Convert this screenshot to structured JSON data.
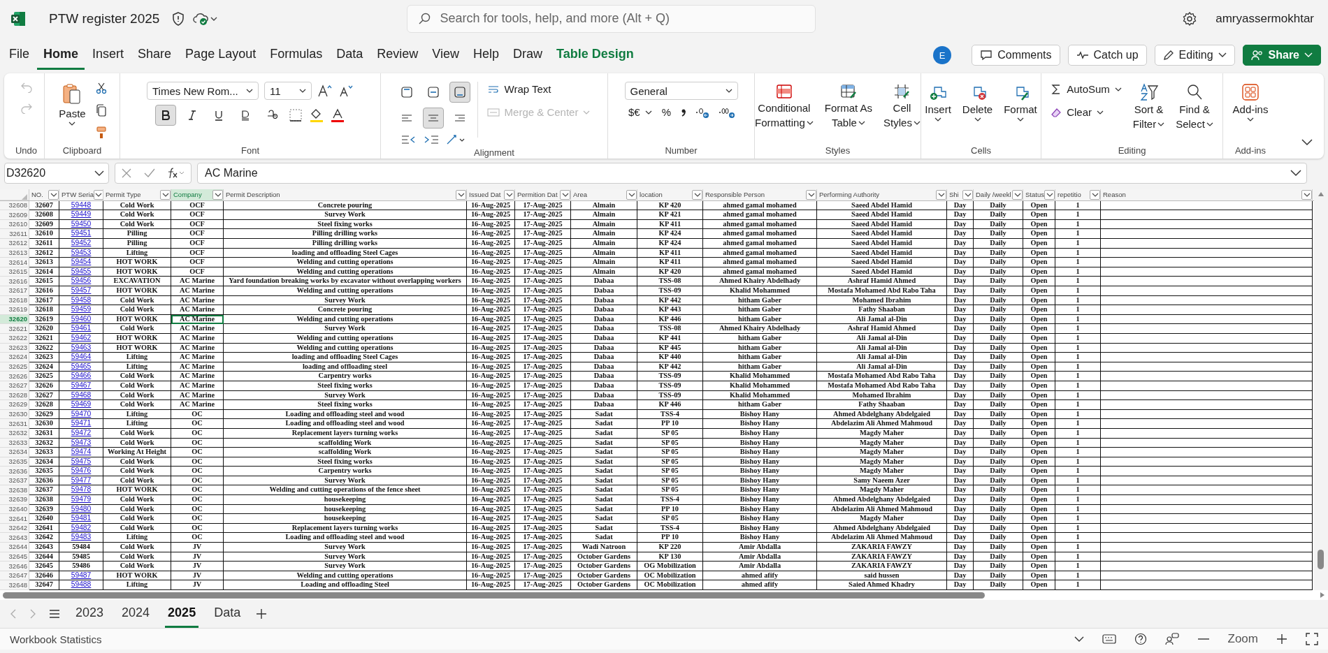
{
  "app": {
    "title": "PTW register 2025",
    "search_placeholder": "Search for tools, help, and more (Alt + Q)",
    "user": "amryassermokhtar"
  },
  "menu_tabs": [
    {
      "label": "File",
      "selected": false,
      "kind": "tab"
    },
    {
      "label": "Home",
      "selected": true,
      "kind": "tab"
    },
    {
      "label": "Insert",
      "selected": false,
      "kind": "tab"
    },
    {
      "label": "Share",
      "selected": false,
      "kind": "tab"
    },
    {
      "label": "Page Layout",
      "selected": false,
      "kind": "tab"
    },
    {
      "label": "Formulas",
      "selected": false,
      "kind": "tab"
    },
    {
      "label": "Data",
      "selected": false,
      "kind": "tab"
    },
    {
      "label": "Review",
      "selected": false,
      "kind": "tab"
    },
    {
      "label": "View",
      "selected": false,
      "kind": "tab"
    },
    {
      "label": "Help",
      "selected": false,
      "kind": "tab"
    },
    {
      "label": "Draw",
      "selected": false,
      "kind": "tab"
    },
    {
      "label": "Table Design",
      "selected": false,
      "kind": "contextual"
    }
  ],
  "header_actions": {
    "avatar": "E",
    "comments": "Comments",
    "catch_up": "Catch up",
    "mode": "Editing",
    "share": "Share"
  },
  "ribbon": {
    "history": {
      "group": "Undo",
      "disabled": true
    },
    "clipboard": {
      "group": "Clipboard",
      "paste": "Paste"
    },
    "font": {
      "group": "Font",
      "family": "Times New Rom...",
      "size": "11",
      "styles": [
        {
          "kind": "bold",
          "selected": true
        },
        {
          "kind": "italic",
          "selected": false
        },
        {
          "kind": "underline",
          "selected": false
        },
        {
          "kind": "double-underline",
          "selected": false
        },
        {
          "kind": "strike",
          "selected": false
        }
      ]
    },
    "alignment": {
      "group": "Alignment",
      "vertical": [
        {
          "kind": "top",
          "selected": false
        },
        {
          "kind": "middle",
          "selected": false
        },
        {
          "kind": "bottom",
          "selected": true
        }
      ],
      "horizontal": [
        {
          "kind": "left",
          "selected": false
        },
        {
          "kind": "center",
          "selected": true
        },
        {
          "kind": "right",
          "selected": false
        }
      ],
      "wrap": "Wrap Text",
      "merge": "Merge & Center",
      "merge_disabled": true
    },
    "number": {
      "group": "Number",
      "format": "General",
      "currency": "$€",
      "percent": "%"
    },
    "styles": {
      "group": "Styles",
      "buttons": [
        {
          "kind": "conditional",
          "lines": [
            "Conditional",
            "Formatting"
          ]
        },
        {
          "kind": "table",
          "lines": [
            "Format As",
            "Table"
          ]
        },
        {
          "kind": "cell",
          "lines": [
            "Cell",
            "Styles"
          ]
        }
      ]
    },
    "cells": {
      "group": "Cells",
      "buttons": [
        {
          "kind": "insert",
          "label": "Insert"
        },
        {
          "kind": "delete",
          "label": "Delete"
        },
        {
          "kind": "format",
          "label": "Format"
        }
      ]
    },
    "editing": {
      "group": "Editing",
      "autosum": "AutoSum",
      "clear": "Clear",
      "buttons": [
        {
          "kind": "sort",
          "lines": [
            "Sort &",
            "Filter"
          ]
        },
        {
          "kind": "find",
          "lines": [
            "Find &",
            "Select"
          ]
        }
      ]
    },
    "addins": {
      "group": "Add-ins",
      "label": "Add-ins"
    }
  },
  "formula_bar": {
    "name_box": "D32620",
    "value": "AC Marine"
  },
  "columns": [
    {
      "label": "NO.",
      "selected": false
    },
    {
      "label": "PTW Seria",
      "selected": false
    },
    {
      "label": "Permit Type",
      "selected": false
    },
    {
      "label": "Company",
      "selected": true
    },
    {
      "label": "Permit Description",
      "selected": false
    },
    {
      "label": "Issued Dat",
      "selected": false
    },
    {
      "label": "Permition Dat",
      "selected": false
    },
    {
      "label": "Area",
      "selected": false
    },
    {
      "label": "location",
      "selected": false
    },
    {
      "label": "Responsible Person",
      "selected": false
    },
    {
      "label": "Performing Authority",
      "selected": false
    },
    {
      "label": "Shi",
      "selected": false
    },
    {
      "label": "Daily /weekl",
      "selected": false
    },
    {
      "label": "Status",
      "selected": false
    },
    {
      "label": "repetitio",
      "selected": false
    },
    {
      "label": "Reason",
      "selected": false
    }
  ],
  "rows": [
    {
      "row": "32608",
      "no": "32607",
      "serial": "59448",
      "link": true,
      "type": "Cold Work",
      "company": "OCF",
      "description": "Concrete pouring",
      "issued": "16-Aug-2025",
      "permition": "17-Aug-2025",
      "area": "Almain",
      "location": "KP 420",
      "responsible": "ahmed gamal mohamed",
      "performing": "Saeed Abdel Hamid",
      "shift": "Day",
      "frequency": "Daily",
      "status": "Open",
      "repetition": "1",
      "selected": false
    },
    {
      "row": "32609",
      "no": "32608",
      "serial": "59449",
      "link": true,
      "type": "Cold Work",
      "company": "OCF",
      "description": "Survey Work",
      "issued": "16-Aug-2025",
      "permition": "17-Aug-2025",
      "area": "Almain",
      "location": "KP 421",
      "responsible": "ahmed gamal mohamed",
      "performing": "Saeed Abdel Hamid",
      "shift": "Day",
      "frequency": "Daily",
      "status": "Open",
      "repetition": "1",
      "selected": false
    },
    {
      "row": "32610",
      "no": "32609",
      "serial": "59450",
      "link": true,
      "type": "Cold Work",
      "company": "OCF",
      "description": "Steel fixing works",
      "issued": "16-Aug-2025",
      "permition": "17-Aug-2025",
      "area": "Almain",
      "location": "KP 411",
      "responsible": "ahmed gamal mohamed",
      "performing": "Saeed Abdel Hamid",
      "shift": "Day",
      "frequency": "Daily",
      "status": "Open",
      "repetition": "1",
      "selected": false
    },
    {
      "row": "32611",
      "no": "32610",
      "serial": "59451",
      "link": true,
      "type": "Pilling",
      "company": "OCF",
      "description": "Pilling drilling works",
      "issued": "16-Aug-2025",
      "permition": "17-Aug-2025",
      "area": "Almain",
      "location": "KP 424",
      "responsible": "ahmed gamal mohamed",
      "performing": "Saeed Abdel Hamid",
      "shift": "Day",
      "frequency": "Daily",
      "status": "Open",
      "repetition": "1",
      "selected": false
    },
    {
      "row": "32612",
      "no": "32611",
      "serial": "59452",
      "link": true,
      "type": "Pilling",
      "company": "OCF",
      "description": "Pilling drilling works",
      "issued": "16-Aug-2025",
      "permition": "17-Aug-2025",
      "area": "Almain",
      "location": "KP 424",
      "responsible": "ahmed gamal mohamed",
      "performing": "Saeed Abdel Hamid",
      "shift": "Day",
      "frequency": "Daily",
      "status": "Open",
      "repetition": "1",
      "selected": false
    },
    {
      "row": "32613",
      "no": "32612",
      "serial": "59453",
      "link": true,
      "type": "Lifting",
      "company": "OCF",
      "description": "loading and offloading  Steel Cages",
      "issued": "16-Aug-2025",
      "permition": "17-Aug-2025",
      "area": "Almain",
      "location": "KP 411",
      "responsible": "ahmed gamal mohamed",
      "performing": "Saeed Abdel Hamid",
      "shift": "Day",
      "frequency": "Daily",
      "status": "Open",
      "repetition": "1",
      "selected": false
    },
    {
      "row": "32614",
      "no": "32613",
      "serial": "59454",
      "link": true,
      "type": "HOT WORK",
      "company": "OCF",
      "description": "Welding and cutting operations",
      "issued": "16-Aug-2025",
      "permition": "17-Aug-2025",
      "area": "Almain",
      "location": "KP 411",
      "responsible": "ahmed gamal mohamed",
      "performing": "Saeed Abdel Hamid",
      "shift": "Day",
      "frequency": "Daily",
      "status": "Open",
      "repetition": "1",
      "selected": false
    },
    {
      "row": "32615",
      "no": "32614",
      "serial": "59455",
      "link": true,
      "type": "HOT WORK",
      "company": "OCF",
      "description": "Welding and cutting operations",
      "issued": "16-Aug-2025",
      "permition": "17-Aug-2025",
      "area": "Almain",
      "location": "KP 420",
      "responsible": "ahmed gamal mohamed",
      "performing": "Saeed Abdel Hamid",
      "shift": "Day",
      "frequency": "Daily",
      "status": "Open",
      "repetition": "1",
      "selected": false
    },
    {
      "row": "32616",
      "no": "32615",
      "serial": "59456",
      "link": true,
      "type": "EXCAVATION",
      "company": "AC Marine",
      "description": "Yard foundation breaking works by excavator without overlapping workers",
      "issued": "16-Aug-2025",
      "permition": "17-Aug-2025",
      "area": "Dabaa",
      "location": "TSS-08",
      "responsible": "Ahmed Khairy Abdelhady",
      "performing": "Ashraf Hamid Ahmed",
      "shift": "Day",
      "frequency": "Daily",
      "status": "Open",
      "repetition": "1",
      "selected": false
    },
    {
      "row": "32617",
      "no": "32616",
      "serial": "59457",
      "link": true,
      "type": "HOT WORK",
      "company": "AC Marine",
      "description": "Welding and cutting operations",
      "issued": "16-Aug-2025",
      "permition": "17-Aug-2025",
      "area": "Dabaa",
      "location": "TSS-09",
      "responsible": "Khalid Mohammed",
      "performing": "Mostafa Mohamed Abd Rabo Taha",
      "shift": "Day",
      "frequency": "Daily",
      "status": "Open",
      "repetition": "1",
      "selected": false
    },
    {
      "row": "32618",
      "no": "32617",
      "serial": "59458",
      "link": true,
      "type": "Cold Work",
      "company": "AC Marine",
      "description": "Survey Work",
      "issued": "16-Aug-2025",
      "permition": "17-Aug-2025",
      "area": "Dabaa",
      "location": "KP 442",
      "responsible": "hitham Gaber",
      "performing": "Mohamed Ibrahim",
      "shift": "Day",
      "frequency": "Daily",
      "status": "Open",
      "repetition": "1",
      "selected": false
    },
    {
      "row": "32619",
      "no": "32618",
      "serial": "59459",
      "link": true,
      "type": "Cold Work",
      "company": "AC Marine",
      "description": "Concrete pouring",
      "issued": "16-Aug-2025",
      "permition": "17-Aug-2025",
      "area": "Dabaa",
      "location": "KP 443",
      "responsible": "hitham Gaber",
      "performing": "Fathy Shaaban",
      "shift": "Day",
      "frequency": "Daily",
      "status": "Open",
      "repetition": "1",
      "selected": false
    },
    {
      "row": "32620",
      "no": "32619",
      "serial": "59460",
      "link": true,
      "type": "HOT WORK",
      "company": "AC Marine",
      "description": "Welding and cutting operations",
      "issued": "16-Aug-2025",
      "permition": "17-Aug-2025",
      "area": "Dabaa",
      "location": "KP 446",
      "responsible": "hitham Gaber",
      "performing": "Ali Jamal al-Din",
      "shift": "Day",
      "frequency": "Daily",
      "status": "Open",
      "repetition": "1",
      "selected": true
    },
    {
      "row": "32621",
      "no": "32620",
      "serial": "59461",
      "link": true,
      "type": "Cold Work",
      "company": "AC Marine",
      "description": "Survey Work",
      "issued": "16-Aug-2025",
      "permition": "17-Aug-2025",
      "area": "Dabaa",
      "location": "TSS-08",
      "responsible": "Ahmed Khairy Abdelhady",
      "performing": "Ashraf Hamid Ahmed",
      "shift": "Day",
      "frequency": "Daily",
      "status": "Open",
      "repetition": "1",
      "selected": false
    },
    {
      "row": "32622",
      "no": "32621",
      "serial": "59462",
      "link": true,
      "type": "HOT WORK",
      "company": "AC Marine",
      "description": "Welding and cutting operations",
      "issued": "16-Aug-2025",
      "permition": "17-Aug-2025",
      "area": "Dabaa",
      "location": "KP 441",
      "responsible": "hitham Gaber",
      "performing": "Ali Jamal al-Din",
      "shift": "Day",
      "frequency": "Daily",
      "status": "Open",
      "repetition": "1",
      "selected": false
    },
    {
      "row": "32623",
      "no": "32622",
      "serial": "59463",
      "link": true,
      "type": "HOT WORK",
      "company": "AC Marine",
      "description": "Welding and cutting operations",
      "issued": "16-Aug-2025",
      "permition": "17-Aug-2025",
      "area": "Dabaa",
      "location": "KP 445",
      "responsible": "hitham Gaber",
      "performing": "Ali Jamal al-Din",
      "shift": "Day",
      "frequency": "Daily",
      "status": "Open",
      "repetition": "1",
      "selected": false
    },
    {
      "row": "32624",
      "no": "32623",
      "serial": "59464",
      "link": true,
      "type": "Lifting",
      "company": "AC Marine",
      "description": "loading and offloading  Steel Cages",
      "issued": "16-Aug-2025",
      "permition": "17-Aug-2025",
      "area": "Dabaa",
      "location": "KP 440",
      "responsible": "hitham Gaber",
      "performing": "Ali Jamal al-Din",
      "shift": "Day",
      "frequency": "Daily",
      "status": "Open",
      "repetition": "1",
      "selected": false
    },
    {
      "row": "32625",
      "no": "32624",
      "serial": "59465",
      "link": true,
      "type": "Lifting",
      "company": "AC Marine",
      "description": "loading and offloading steel",
      "issued": "16-Aug-2025",
      "permition": "17-Aug-2025",
      "area": "Dabaa",
      "location": "KP 442",
      "responsible": "hitham Gaber",
      "performing": "Ali Jamal al-Din",
      "shift": "Day",
      "frequency": "Daily",
      "status": "Open",
      "repetition": "1",
      "selected": false
    },
    {
      "row": "32626",
      "no": "32625",
      "serial": "59466",
      "link": true,
      "type": "Cold Work",
      "company": "AC Marine",
      "description": "Carpentry works",
      "issued": "16-Aug-2025",
      "permition": "17-Aug-2025",
      "area": "Dabaa",
      "location": "TSS-09",
      "responsible": "Khalid Mohammed",
      "performing": "Mostafa Mohamed Abd Rabo Taha",
      "shift": "Day",
      "frequency": "Daily",
      "status": "Open",
      "repetition": "1",
      "selected": false
    },
    {
      "row": "32627",
      "no": "32626",
      "serial": "59467",
      "link": true,
      "type": "Cold Work",
      "company": "AC Marine",
      "description": "Steel fixing works",
      "issued": "16-Aug-2025",
      "permition": "17-Aug-2025",
      "area": "Dabaa",
      "location": "TSS-09",
      "responsible": "Khalid Mohammed",
      "performing": "Mostafa Mohamed Abd Rabo Taha",
      "shift": "Day",
      "frequency": "Daily",
      "status": "Open",
      "repetition": "1",
      "selected": false
    },
    {
      "row": "32628",
      "no": "32627",
      "serial": "59468",
      "link": true,
      "type": "Cold Work",
      "company": "AC Marine",
      "description": "Survey Work",
      "issued": "16-Aug-2025",
      "permition": "17-Aug-2025",
      "area": "Dabaa",
      "location": "TSS-09",
      "responsible": "Khalid Mohammed",
      "performing": "Mohamed Ibrahim",
      "shift": "Day",
      "frequency": "Daily",
      "status": "Open",
      "repetition": "1",
      "selected": false
    },
    {
      "row": "32629",
      "no": "32628",
      "serial": "59469",
      "link": true,
      "type": "Cold Work",
      "company": "AC Marine",
      "description": "Steel fixing works",
      "issued": "16-Aug-2025",
      "permition": "17-Aug-2025",
      "area": "Dabaa",
      "location": "KP 446",
      "responsible": "hitham Gaber",
      "performing": "Fathy Shaaban",
      "shift": "Day",
      "frequency": "Daily",
      "status": "Open",
      "repetition": "1",
      "selected": false
    },
    {
      "row": "32630",
      "no": "32629",
      "serial": "59470",
      "link": true,
      "type": "Lifting",
      "company": "OC",
      "description": "Loading and offloading steel and wood",
      "issued": "16-Aug-2025",
      "permition": "17-Aug-2025",
      "area": "Sadat",
      "location": "TSS-4",
      "responsible": "Bishoy Hany",
      "performing": "Ahmed Abdelghany Abdelgaied",
      "shift": "Day",
      "frequency": "Daily",
      "status": "Open",
      "repetition": "1",
      "selected": false
    },
    {
      "row": "32631",
      "no": "32630",
      "serial": "59471",
      "link": true,
      "type": "Lifting",
      "company": "OC",
      "description": "Loading and offloading steel and wood",
      "issued": "16-Aug-2025",
      "permition": "17-Aug-2025",
      "area": "Sadat",
      "location": "PP 10",
      "responsible": "Bishoy Hany",
      "performing": "Abdelazim Ali Ahmed Mahmoud",
      "shift": "Day",
      "frequency": "Daily",
      "status": "Open",
      "repetition": "1",
      "selected": false
    },
    {
      "row": "32632",
      "no": "32631",
      "serial": "59472",
      "link": true,
      "type": "Cold Work",
      "company": "OC",
      "description": "Replacement layers turning works",
      "issued": "16-Aug-2025",
      "permition": "17-Aug-2025",
      "area": "Sadat",
      "location": "SP 05",
      "responsible": "Bishoy Hany",
      "performing": "Magdy Maher",
      "shift": "Day",
      "frequency": "Daily",
      "status": "Open",
      "repetition": "1",
      "selected": false
    },
    {
      "row": "32633",
      "no": "32632",
      "serial": "59473",
      "link": true,
      "type": "Cold Work",
      "company": "OC",
      "description": "scaffolding Work",
      "issued": "16-Aug-2025",
      "permition": "17-Aug-2025",
      "area": "Sadat",
      "location": "SP 05",
      "responsible": "Bishoy Hany",
      "performing": "Magdy Maher",
      "shift": "Day",
      "frequency": "Daily",
      "status": "Open",
      "repetition": "1",
      "selected": false
    },
    {
      "row": "32634",
      "no": "32633",
      "serial": "59474",
      "link": true,
      "type": "Working At Height",
      "company": "OC",
      "description": "scaffolding Work",
      "issued": "16-Aug-2025",
      "permition": "17-Aug-2025",
      "area": "Sadat",
      "location": "SP 05",
      "responsible": "Bishoy Hany",
      "performing": "Magdy Maher",
      "shift": "Day",
      "frequency": "Daily",
      "status": "Open",
      "repetition": "1",
      "selected": false
    },
    {
      "row": "32635",
      "no": "32634",
      "serial": "59475",
      "link": true,
      "type": "Cold Work",
      "company": "OC",
      "description": "Steel fixing works",
      "issued": "16-Aug-2025",
      "permition": "17-Aug-2025",
      "area": "Sadat",
      "location": "SP 05",
      "responsible": "Bishoy Hany",
      "performing": "Magdy Maher",
      "shift": "Day",
      "frequency": "Daily",
      "status": "Open",
      "repetition": "1",
      "selected": false
    },
    {
      "row": "32636",
      "no": "32635",
      "serial": "59476",
      "link": true,
      "type": "Cold Work",
      "company": "OC",
      "description": "Carpentry works",
      "issued": "16-Aug-2025",
      "permition": "17-Aug-2025",
      "area": "Sadat",
      "location": "SP 05",
      "responsible": "Bishoy Hany",
      "performing": "Magdy Maher",
      "shift": "Day",
      "frequency": "Daily",
      "status": "Open",
      "repetition": "1",
      "selected": false
    },
    {
      "row": "32637",
      "no": "32636",
      "serial": "59477",
      "link": true,
      "type": "Cold Work",
      "company": "OC",
      "description": "Survey Work",
      "issued": "16-Aug-2025",
      "permition": "17-Aug-2025",
      "area": "Sadat",
      "location": "SP 05",
      "responsible": "Bishoy Hany",
      "performing": "Samy Naeem Azer",
      "shift": "Day",
      "frequency": "Daily",
      "status": "Open",
      "repetition": "1",
      "selected": false
    },
    {
      "row": "32638",
      "no": "32637",
      "serial": "59478",
      "link": true,
      "type": "HOT WORK",
      "company": "OC",
      "description": "Welding and cutting operations of the fence sheet",
      "issued": "16-Aug-2025",
      "permition": "17-Aug-2025",
      "area": "Sadat",
      "location": "SP 05",
      "responsible": "Bishoy Hany",
      "performing": "Magdy Maher",
      "shift": "Day",
      "frequency": "Daily",
      "status": "Open",
      "repetition": "1",
      "selected": false
    },
    {
      "row": "32639",
      "no": "32638",
      "serial": "59479",
      "link": true,
      "type": "Cold Work",
      "company": "OC",
      "description": "housekeeping",
      "issued": "16-Aug-2025",
      "permition": "17-Aug-2025",
      "area": "Sadat",
      "location": "TSS-4",
      "responsible": "Bishoy Hany",
      "performing": "Ahmed Abdelghany Abdelgaied",
      "shift": "Day",
      "frequency": "Daily",
      "status": "Open",
      "repetition": "1",
      "selected": false
    },
    {
      "row": "32640",
      "no": "32639",
      "serial": "59480",
      "link": true,
      "type": "Cold Work",
      "company": "OC",
      "description": "housekeeping",
      "issued": "16-Aug-2025",
      "permition": "17-Aug-2025",
      "area": "Sadat",
      "location": "PP 10",
      "responsible": "Bishoy Hany",
      "performing": "Abdelazim Ali Ahmed Mahmoud",
      "shift": "Day",
      "frequency": "Daily",
      "status": "Open",
      "repetition": "1",
      "selected": false
    },
    {
      "row": "32641",
      "no": "32640",
      "serial": "59481",
      "link": true,
      "type": "Cold Work",
      "company": "OC",
      "description": "housekeeping",
      "issued": "16-Aug-2025",
      "permition": "17-Aug-2025",
      "area": "Sadat",
      "location": "SP 05",
      "responsible": "Bishoy Hany",
      "performing": "Magdy Maher",
      "shift": "Day",
      "frequency": "Daily",
      "status": "Open",
      "repetition": "1",
      "selected": false
    },
    {
      "row": "32642",
      "no": "32641",
      "serial": "59482",
      "link": true,
      "type": "Cold Work",
      "company": "OC",
      "description": "Replacement layers turning works",
      "issued": "16-Aug-2025",
      "permition": "17-Aug-2025",
      "area": "Sadat",
      "location": "TSS-4",
      "responsible": "Bishoy Hany",
      "performing": "Ahmed Abdelghany Abdelgaied",
      "shift": "Day",
      "frequency": "Daily",
      "status": "Open",
      "repetition": "1",
      "selected": false
    },
    {
      "row": "32643",
      "no": "32642",
      "serial": "59483",
      "link": true,
      "type": "Lifting",
      "company": "OC",
      "description": "Loading and offloading steel and wood",
      "issued": "16-Aug-2025",
      "permition": "17-Aug-2025",
      "area": "Sadat",
      "location": "PP 10",
      "responsible": "Bishoy Hany",
      "performing": "Abdelazim Ali Ahmed Mahmoud",
      "shift": "Day",
      "frequency": "Daily",
      "status": "Open",
      "repetition": "1",
      "selected": false
    },
    {
      "row": "32644",
      "no": "32643",
      "serial": "59484",
      "link": false,
      "type": "Cold Work",
      "company": "JV",
      "description": "Survey Work",
      "issued": "16-Aug-2025",
      "permition": "17-Aug-2025",
      "area": "Wadi Natroon",
      "location": "KP 220",
      "responsible": "Amir Abdalla",
      "performing": "ZAKARIA FAWZY",
      "shift": "Day",
      "frequency": "Daily",
      "status": "Open",
      "repetition": "1",
      "selected": false
    },
    {
      "row": "32645",
      "no": "32644",
      "serial": "59485",
      "link": false,
      "type": "Cold Work",
      "company": "JV",
      "description": "Survey Work",
      "issued": "16-Aug-2025",
      "permition": "17-Aug-2025",
      "area": "October Gardens",
      "location": "KP 130",
      "responsible": "Amir Abdalla",
      "performing": "ZAKARIA FAWZY",
      "shift": "Day",
      "frequency": "Daily",
      "status": "Open",
      "repetition": "1",
      "selected": false
    },
    {
      "row": "32646",
      "no": "32645",
      "serial": "59486",
      "link": false,
      "type": "Cold Work",
      "company": "JV",
      "description": "Survey Work",
      "issued": "16-Aug-2025",
      "permition": "17-Aug-2025",
      "area": "October Gardens",
      "location": "OG Mobilization",
      "responsible": "Amir Abdalla",
      "performing": "ZAKARIA FAWZY",
      "shift": "Day",
      "frequency": "Daily",
      "status": "Open",
      "repetition": "1",
      "selected": false
    },
    {
      "row": "32647",
      "no": "32646",
      "serial": "59487",
      "link": true,
      "type": "HOT WORK",
      "company": "JV",
      "description": "Welding and cutting operations",
      "issued": "16-Aug-2025",
      "permition": "17-Aug-2025",
      "area": "October Gardens",
      "location": "OC Mobilization",
      "responsible": "ahmed afify",
      "performing": "said hussen",
      "shift": "Day",
      "frequency": "Daily",
      "status": "Open",
      "repetition": "1",
      "selected": false
    },
    {
      "row": "32648",
      "no": "32647",
      "serial": "59488",
      "link": true,
      "type": "Lifting",
      "company": "JV",
      "description": "Loading and offloading  Steel",
      "issued": "16-Aug-2025",
      "permition": "17-Aug-2025",
      "area": "October Gardens",
      "location": "OC Mobilization",
      "responsible": "ahmed afify",
      "performing": "Saied Ahmed Khadry",
      "shift": "Day",
      "frequency": "Daily",
      "status": "Open",
      "repetition": "1",
      "selected": false
    }
  ],
  "sheet_tabs": [
    {
      "label": "2023",
      "selected": false
    },
    {
      "label": "2024",
      "selected": false
    },
    {
      "label": "2025",
      "selected": true
    },
    {
      "label": "Data",
      "selected": false
    }
  ],
  "status_bar": {
    "left": "Workbook Statistics",
    "zoom": "Zoom"
  }
}
